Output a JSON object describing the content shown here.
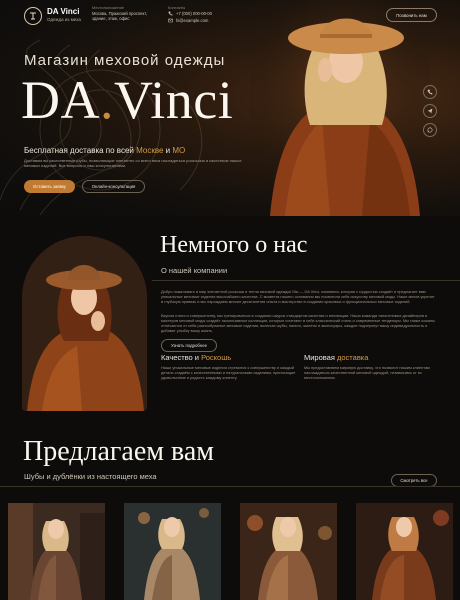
{
  "header": {
    "brand": "DA Vinci",
    "brand_sub": "Одежда из меха",
    "address_label": "Местоположение",
    "address": "Москва, Пражский проспект, здание, этаж, офис",
    "contacts_label": "Контакты",
    "phone": "+7 (000) 000-00-00",
    "email": "hi@example.com",
    "call_button": "Позвонить нам"
  },
  "hero": {
    "kicker": "Магазин меховой одежды",
    "title_part1": "DA",
    "title_dot": ".",
    "title_part2": "Vinci",
    "delivery_prefix": "Бесплатная доставка по всей ",
    "delivery_city1": "Москве",
    "delivery_and": " и ",
    "delivery_city2": "МО",
    "description": "Доставим вы качественные шубы, позволяющие элегантно со всего века насладиться роскошью и качеством наших меховых изделий. Все вопросы и наш консультантами.",
    "primary_button": "Оставить заявку",
    "secondary_button": "Онлайн-консультация",
    "socials": [
      "phone-icon",
      "telegram-icon",
      "whatsapp-icon"
    ]
  },
  "about": {
    "title": "Немного о нас",
    "subtitle": "О нашей компании",
    "paragraph1": "Добро пожаловать в мир элегантной роскоши и тепла меховой одежды! Мы — DA Vinci, компания, которая с гордостью создаёт и предлагает вам уникальные меховые изделия высочайшего качества. С момента нашего основания мы посвятили себя искусству меховой моды. Наше мехов укрепит в глубокую привязь и мы нарождаем многие десятилетия опыта и мастерство в создании красивых и функциональных меховых изделий.",
    "paragraph2": "Вкусом стиля и совершенству, мы тренироваться в создании шкурок стандартом качества и инновации. Наша команда талантливых дизайнеров и мастеров меховой моды создаёт эксклюзивные коллекции, которые сочетают в себе классический стиль и современные тенденции. Мы также кожаны отличаются от себя разнообразные меховые изделия, включая шубы, пальто, жилеты и аксессуары, каждое подчеркнут вашу индивидуальность и добавят улыбку вашу жизнь.",
    "button": "Узнать подробнее",
    "feature1_title_a": "Качество",
    "feature1_title_b": " и ",
    "feature1_title_c": "Роскошь",
    "feature1_text": "Наши уникальные меховые изделия стремятся к совершенству и каждый деталь создаём с качественными и натуральными изделиям, приносящие удовольствие и радость каждому клиенту.",
    "feature2_title_a": "Мировая ",
    "feature2_title_b": "доставка",
    "feature2_text": "Мы предоставляем мировую доставку, что позволит нашим клиентам наслаждаться качественной меховой одеждой, независимо от их местоположения."
  },
  "offer": {
    "title": "Предлагаем вам",
    "subtitle": "Шубы и дублёнки из настоящего меха",
    "button": "Смотреть все"
  },
  "colors": {
    "accent": "#c07a32",
    "accent_text": "#d69a45",
    "bg": "#0d0c0b"
  }
}
